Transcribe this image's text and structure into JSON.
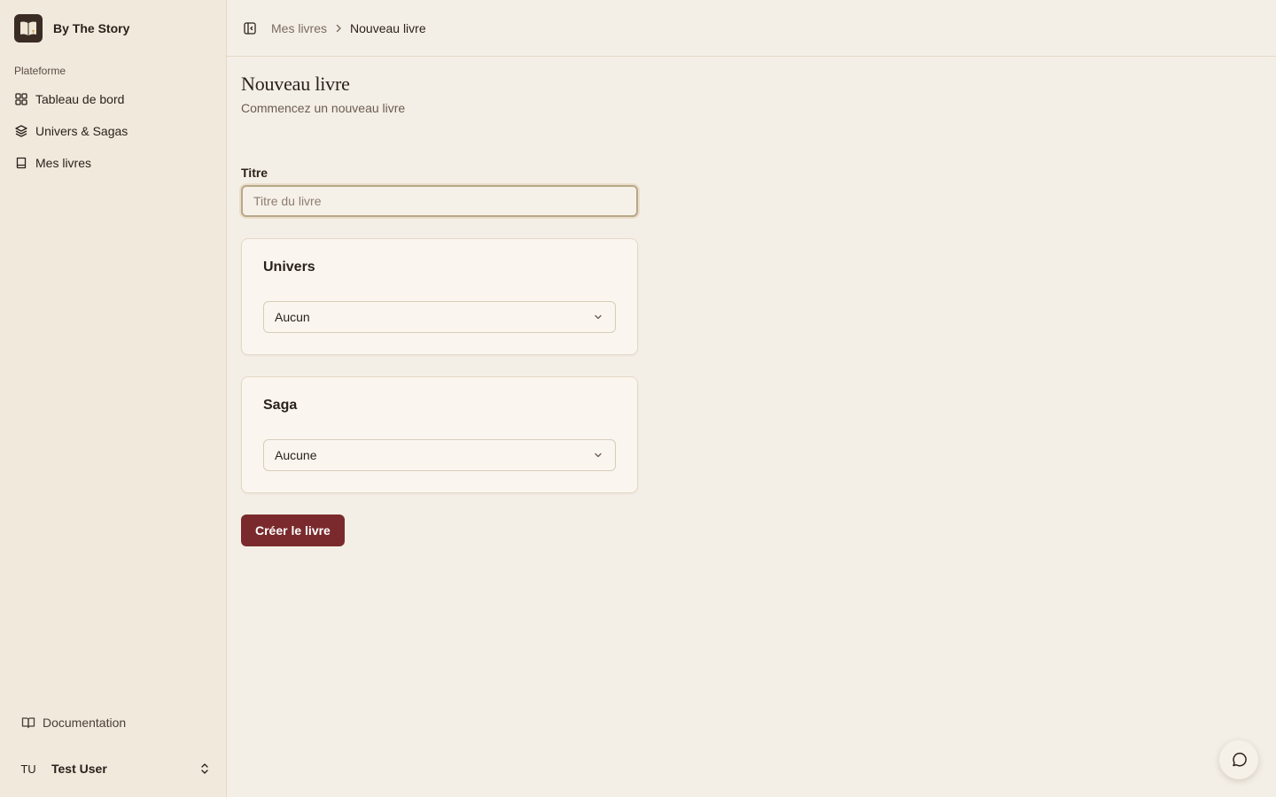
{
  "brand": {
    "name": "By The Story",
    "logo_icon": "open-book-icon"
  },
  "sidebar": {
    "group_label": "Plateforme",
    "items": [
      {
        "label": "Tableau de bord",
        "icon": "grid-icon"
      },
      {
        "label": "Univers & Sagas",
        "icon": "layers-icon"
      },
      {
        "label": "Mes livres",
        "icon": "book-icon"
      }
    ],
    "documentation": {
      "label": "Documentation",
      "icon": "book-open-icon"
    },
    "user": {
      "initials": "TU",
      "name": "Test User",
      "icon": "chevrons-up-down-icon"
    }
  },
  "header": {
    "breadcrumb": [
      {
        "label": "Mes livres"
      },
      {
        "label": "Nouveau livre"
      }
    ]
  },
  "page": {
    "title": "Nouveau livre",
    "subtitle": "Commencez un nouveau livre"
  },
  "form": {
    "title_label": "Titre",
    "title_value": "",
    "title_placeholder": "Titre du livre",
    "universe": {
      "label": "Univers",
      "selected": "Aucun"
    },
    "saga": {
      "label": "Saga",
      "selected": "Aucune"
    },
    "submit_label": "Créer le livre"
  },
  "colors": {
    "sidebar_bg": "#f1e9dc",
    "page_bg": "#f4efe6",
    "primary": "#7a2a2c",
    "text": "#2b211c"
  }
}
